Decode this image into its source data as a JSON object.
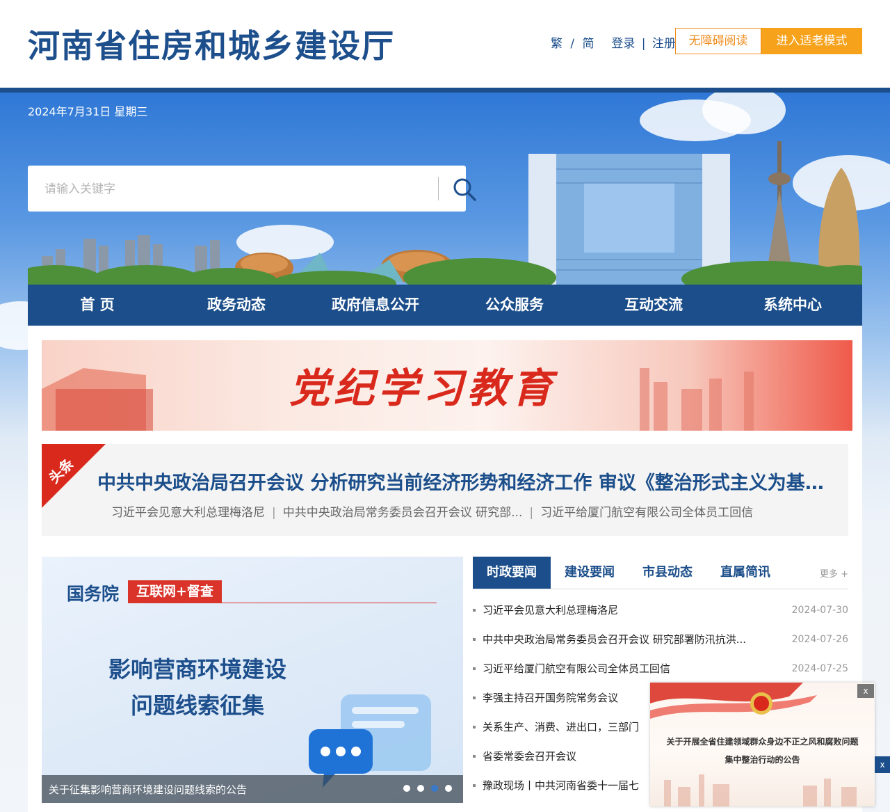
{
  "header": {
    "site_title": "河南省住房和城乡建设厅",
    "lang_trad": "繁",
    "lang_sep": "/",
    "lang_simp": "简",
    "login": "登录",
    "link_sep": "|",
    "register": "注册",
    "accessible_reading": "无障碍阅读",
    "elder_mode": "进入适老模式"
  },
  "banner": {
    "date": "2024年7月31日 星期三",
    "search_placeholder": "请输入关键字"
  },
  "nav": {
    "items": [
      {
        "label": "首 页"
      },
      {
        "label": "政务动态"
      },
      {
        "label": "政府信息公开"
      },
      {
        "label": "公众服务"
      },
      {
        "label": "互动交流"
      },
      {
        "label": "系统中心"
      }
    ]
  },
  "party_banner": {
    "title": "党纪学习教育"
  },
  "headline": {
    "tag": "头条",
    "title": "中共中央政治局召开会议 分析研究当前经济形势和经济工作 审议《整治形式主义为基层减负若干规定》",
    "subs": [
      "习近平会见意大利总理梅洛尼",
      "中共中央政治局常务委员会召开会议 研究部...",
      "习近平给厦门航空有限公司全体员工回信"
    ]
  },
  "carousel": {
    "org": "国务院",
    "tag": "互联网+督查",
    "main_line1": "影响营商环境建设",
    "main_line2": "问题线索征集",
    "caption": "关于征集影响营商环境建设问题线索的公告",
    "active_dot": 3
  },
  "news": {
    "tabs": [
      {
        "label": "时政要闻",
        "active": true
      },
      {
        "label": "建设要闻",
        "active": false
      },
      {
        "label": "市县动态",
        "active": false
      },
      {
        "label": "直属简讯",
        "active": false
      }
    ],
    "more": "更多 +",
    "items": [
      {
        "title": "习近平会见意大利总理梅洛尼",
        "date": "2024-07-30"
      },
      {
        "title": "中共中央政治局常务委员会召开会议 研究部署防汛抗洪...",
        "date": "2024-07-26"
      },
      {
        "title": "习近平给厦门航空有限公司全体员工回信",
        "date": "2024-07-25"
      },
      {
        "title": "李强主持召开国务院常务会议",
        "date": ""
      },
      {
        "title": "关系生产、消费、进出口，三部门",
        "date": ""
      },
      {
        "title": "省委常委会召开会议",
        "date": ""
      },
      {
        "title": "豫政现场丨中共河南省委十一届七",
        "date": ""
      }
    ]
  },
  "popup": {
    "line1": "关于开展全省住建领域群众身边不正之风和腐败问题",
    "line2": "集中整治行动的公告",
    "close": "x"
  },
  "side_close": "x",
  "colors": {
    "brand_blue": "#1b4e8a",
    "accent_orange": "#f7a21b",
    "party_red": "#d9291c"
  }
}
